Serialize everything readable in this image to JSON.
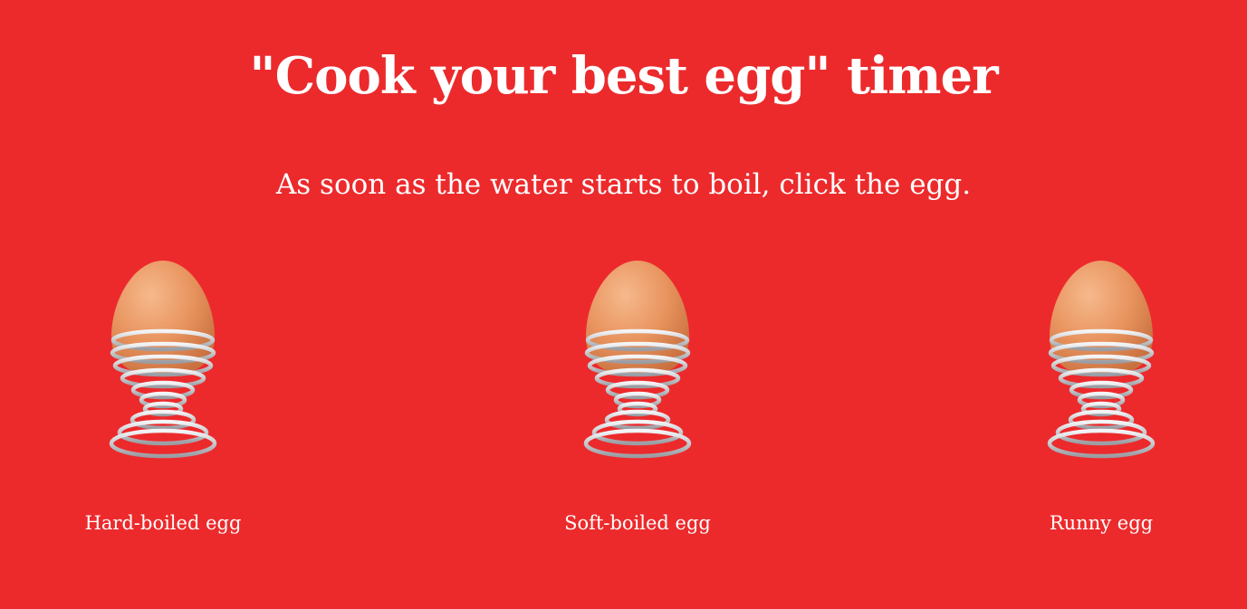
{
  "page": {
    "title": "\"Cook your best egg\" timer",
    "instruction": "As soon as the water starts to boil, click the egg.",
    "background_color": "#EC2A2C",
    "text_color": "#FFFFFF"
  },
  "eggs": [
    {
      "label": "Hard-boiled egg",
      "icon": "egg-in-cup-icon"
    },
    {
      "label": "Soft-boiled egg",
      "icon": "egg-in-cup-icon"
    },
    {
      "label": "Runny egg",
      "icon": "egg-in-cup-icon"
    }
  ],
  "colors": {
    "egg_shell": "#E8935E",
    "egg_highlight": "#F6B98C",
    "wire": "#C9CBCF"
  }
}
